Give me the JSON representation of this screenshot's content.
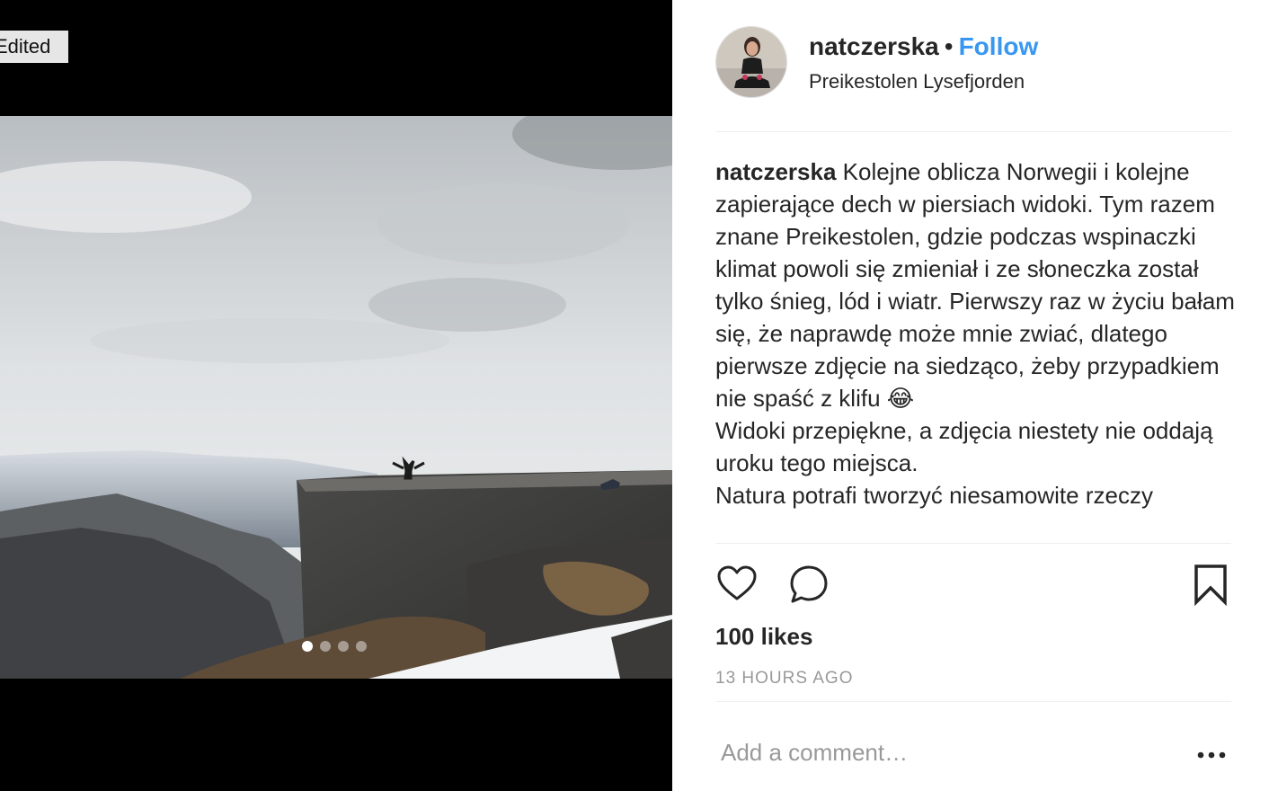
{
  "media": {
    "edited_label": "Edited",
    "carousel": {
      "count": 4,
      "active_index": 0
    }
  },
  "header": {
    "username": "natczerska",
    "separator": "•",
    "follow_label": "Follow",
    "location": "Preikestolen Lysefjorden"
  },
  "caption": {
    "username": "natczerska",
    "text": "Kolejne oblicza Norwegii i kolejne zapierające dech w piersiach widoki. Tym razem znane Preikestolen, gdzie podczas wspinaczki klimat powoli się zmieniał i ze słoneczka został tylko śnieg, lód i wiatr. Pierwszy raz w życiu bałam się, że naprawdę może mnie zwiać, dlatego pierwsze zdjęcie na siedząco, żeby przypadkiem nie spaść z klifu 😂",
    "line2": "Widoki przepiękne, a zdjęcia niestety nie oddają uroku tego miejsca.",
    "line3": "Natura potrafi tworzyć niesamowite rzeczy"
  },
  "actions": {
    "like_icon": "heart-outline-icon",
    "comment_icon": "speech-bubble-icon",
    "save_icon": "bookmark-outline-icon"
  },
  "likes": "100 likes",
  "timestamp": "13 HOURS AGO",
  "comment": {
    "placeholder": "Add a comment…",
    "more_icon": "ellipsis-icon"
  },
  "colors": {
    "link": "#3897f0",
    "text": "#262626",
    "muted": "#999999",
    "divider": "#efefef"
  }
}
